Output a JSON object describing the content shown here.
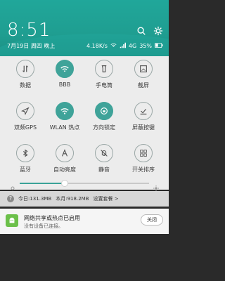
{
  "header": {
    "time": "8:51",
    "date": "7月19日 周四 晚上",
    "network_speed": "4.18K/s",
    "network_type": "4G",
    "battery": "35%",
    "icons": [
      "search-icon",
      "gear-icon"
    ]
  },
  "tiles": [
    {
      "label": "数据",
      "icon": "updown-icon",
      "active": false
    },
    {
      "label": "BBB",
      "icon": "wifi-icon",
      "active": true
    },
    {
      "label": "手电筒",
      "icon": "flashlight-icon",
      "active": false
    },
    {
      "label": "截屏",
      "icon": "screenshot-icon",
      "active": false
    },
    {
      "label": "双频GPS",
      "icon": "location-icon",
      "active": false
    },
    {
      "label": "WLAN 热点",
      "icon": "hotspot-icon",
      "active": true
    },
    {
      "label": "方向锁定",
      "icon": "rotation-lock-icon",
      "active": true
    },
    {
      "label": "屏蔽按键",
      "icon": "block-keys-icon",
      "active": false
    },
    {
      "label": "蓝牙",
      "icon": "bluetooth-icon",
      "active": false
    },
    {
      "label": "自动亮度",
      "icon": "auto-brightness-icon",
      "active": false
    },
    {
      "label": "静音",
      "icon": "mute-icon",
      "active": false
    },
    {
      "label": "开关排序",
      "icon": "sort-icon",
      "active": false
    }
  ],
  "brightness": {
    "level": 0.35
  },
  "data_usage": {
    "today": "今日:131.3MB",
    "month": "本月:918.2MB",
    "settings": "设置套餐 >"
  },
  "notification": {
    "title": "网络共享或热点已启用",
    "subtitle": "没有设备已连接。",
    "button": "关闭"
  },
  "colors": {
    "accent": "#3fa399",
    "header": "#20a79a",
    "panel": "#ececec"
  }
}
